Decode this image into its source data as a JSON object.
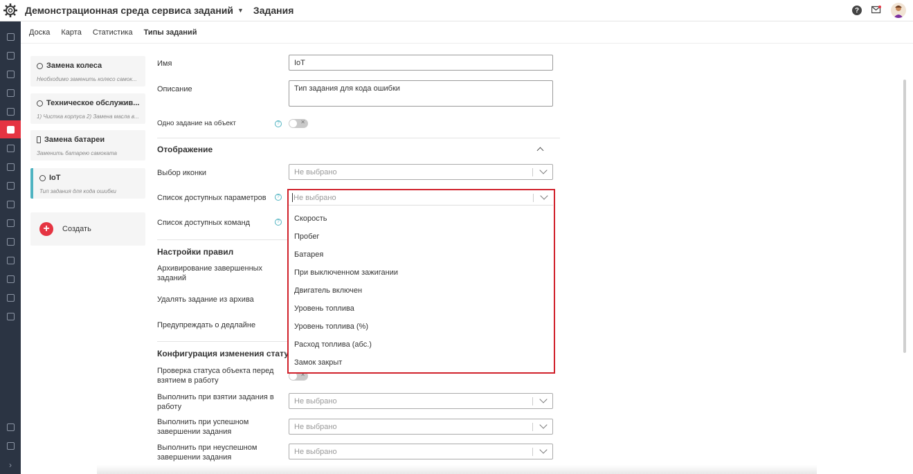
{
  "header": {
    "app_title": "Демонстрационная среда сервиса заданий",
    "section_title": "Задания"
  },
  "tabs": [
    {
      "label": "Доска"
    },
    {
      "label": "Карта"
    },
    {
      "label": "Статистика"
    },
    {
      "label": "Типы заданий"
    }
  ],
  "task_types": [
    {
      "title": "Замена колеса",
      "subtitle": "Необходимо заменить колесо самок..."
    },
    {
      "title": "Техническое обслужив...",
      "subtitle": "1) Чистка корпуса 2) Замена масла в..."
    },
    {
      "title": "Замена батареи",
      "subtitle": "Заменить батарею самоката"
    },
    {
      "title": "IoT",
      "subtitle": "Тип задания для кода ошибки"
    }
  ],
  "create_label": "Создать",
  "form": {
    "name_label": "Имя",
    "name_value": "IoT",
    "description_label": "Описание",
    "description_value": "Тип задания для кода ошибки",
    "one_task_label": "Одно задание на объект",
    "display_heading": "Отображение",
    "icon_label": "Выбор иконки",
    "params_label": "Список доступных параметров",
    "commands_label": "Список доступных команд",
    "rules_heading": "Настройки правил",
    "archive_label": "Архивирование завершенных заданий",
    "delete_label": "Удалять задание из архива",
    "deadline_label": "Предупреждать о дедлайне",
    "status_heading": "Конфигурация изменения стату",
    "check_status_label": "Проверка статуса объекта перед взятием в работу",
    "on_take_label": "Выполнить при взятии задания в работу",
    "on_success_label": "Выполнить при успешном завершении задания",
    "on_fail_label": "Выполнить при неуспешном завершении задания",
    "placeholder": "Не выбрано"
  },
  "dropdown_options": [
    "Скорость",
    "Пробег",
    "Батарея",
    "При выключенном зажигании",
    "Двигатель включен",
    "Уровень топлива",
    "Уровень топлива (%)",
    "Расход топлива (абс.)",
    "Замок закрыт"
  ],
  "colors": {
    "accent_red": "#e53442",
    "accent_teal": "#4fb3c1",
    "sidebar_bg": "#2b3443",
    "highlight_border": "#d0202a"
  }
}
